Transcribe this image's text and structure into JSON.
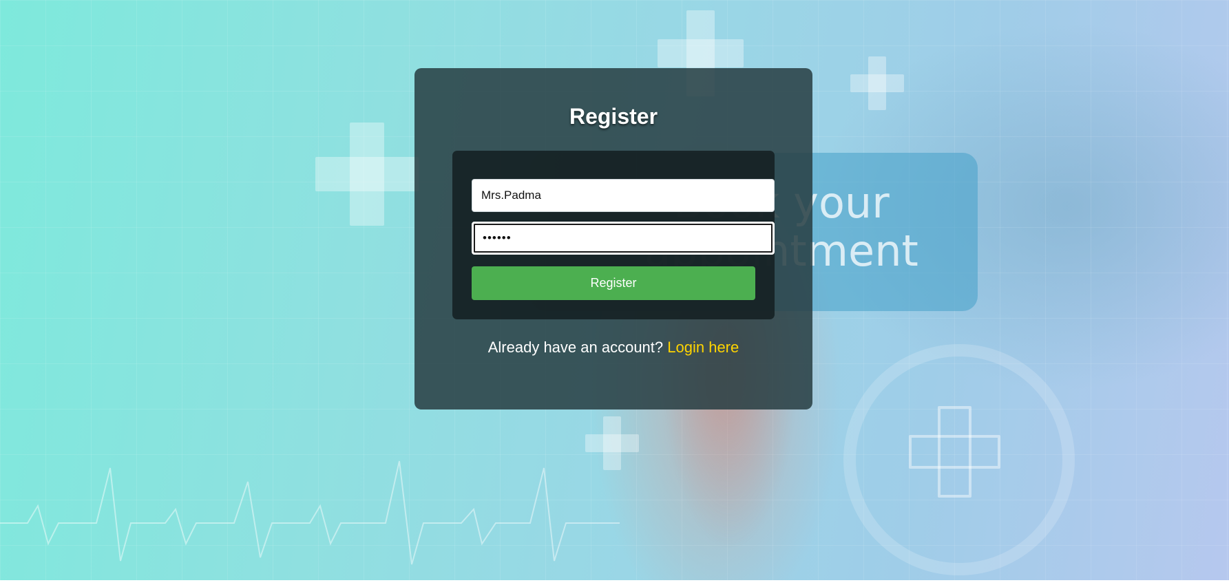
{
  "background": {
    "banner_line_1": "Book your",
    "banner_line_2": "appointment"
  },
  "register": {
    "title": "Register",
    "username_value": "Mrs.Padma",
    "password_value": "••••••",
    "submit_label": "Register",
    "login_prompt": "Already have an account?",
    "login_link": "Login here"
  },
  "colors": {
    "submit_button": "#4caf50",
    "link": "#ffd400",
    "panel": "#283e42"
  }
}
